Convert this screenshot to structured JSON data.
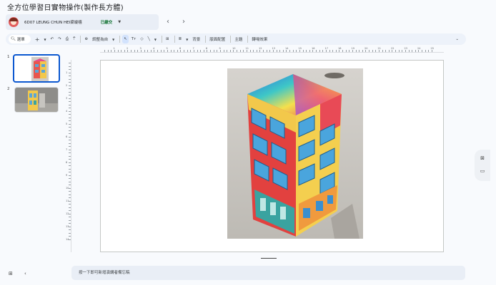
{
  "page": {
    "title": "全方位學習日實物操作(製作長方體)"
  },
  "student_bar": {
    "name": "6D07 LEUNG CHUN HEI梁竣禧",
    "status": "已繳交",
    "status_color": "#137333"
  },
  "nav": {
    "prev": "‹",
    "next": "›"
  },
  "toolbar": {
    "menu_label": "選單",
    "add": "+",
    "undo": "↶",
    "redo": "↷",
    "print": "⎙",
    "paint_format": "⍑",
    "zoom_label": "調整為自",
    "select": "↖",
    "text_box": "Tт",
    "shape": "◇",
    "line": "╲",
    "comment": "⊞",
    "align": "≣",
    "background": "背景",
    "layout": "版面配置",
    "theme": "主題",
    "transition": "轉場效果",
    "collapse": "⌄"
  },
  "ruler": {
    "h_labels": [
      "1",
      "2",
      "3",
      "4",
      "5",
      "6",
      "7",
      "8",
      "9",
      "10",
      "11",
      "12",
      "13",
      "14",
      "15",
      "16",
      "17",
      "18",
      "19",
      "20",
      "21",
      "22",
      "23",
      "24",
      "25"
    ],
    "v_labels": [
      "1",
      "2",
      "3",
      "4",
      "5",
      "6",
      "7",
      "8",
      "9",
      "10",
      "11",
      "12",
      "13",
      "14"
    ]
  },
  "slides": [
    {
      "number": "1"
    },
    {
      "number": "2"
    }
  ],
  "side_buttons": {
    "keep": "⊠",
    "folder": "▭"
  },
  "notes": {
    "placeholder": "按一下即可新增演講者備忘稿"
  },
  "bottom": {
    "grid": "⊞",
    "collapse": "‹"
  },
  "colors": {
    "accent": "#0b57d0",
    "toolbar_bg": "#edf2fa"
  }
}
